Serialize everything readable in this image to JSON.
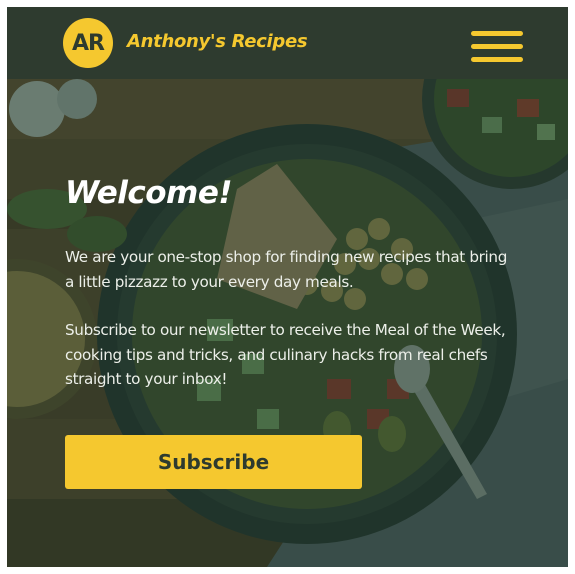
{
  "header": {
    "logo_initials": "AR",
    "brand_name": "Anthony's Recipes",
    "menu_icon": "hamburger-icon"
  },
  "hero": {
    "title": "Welcome!",
    "paragraph_1": "We are your one-stop shop for finding new recipes that bring a little pizzazz to your every day meals.",
    "paragraph_2": "Subscribe to our newsletter to receive the Meal of the Week, cooking tips and tricks, and culinary hacks from real chefs straight to your inbox!",
    "subscribe_label": "Subscribe",
    "background_image": "food-bowl-photo"
  },
  "colors": {
    "header_bg": "#2e3b2f",
    "accent": "#f5c82f",
    "overlay": "#223a28",
    "text": "#ffffff"
  }
}
